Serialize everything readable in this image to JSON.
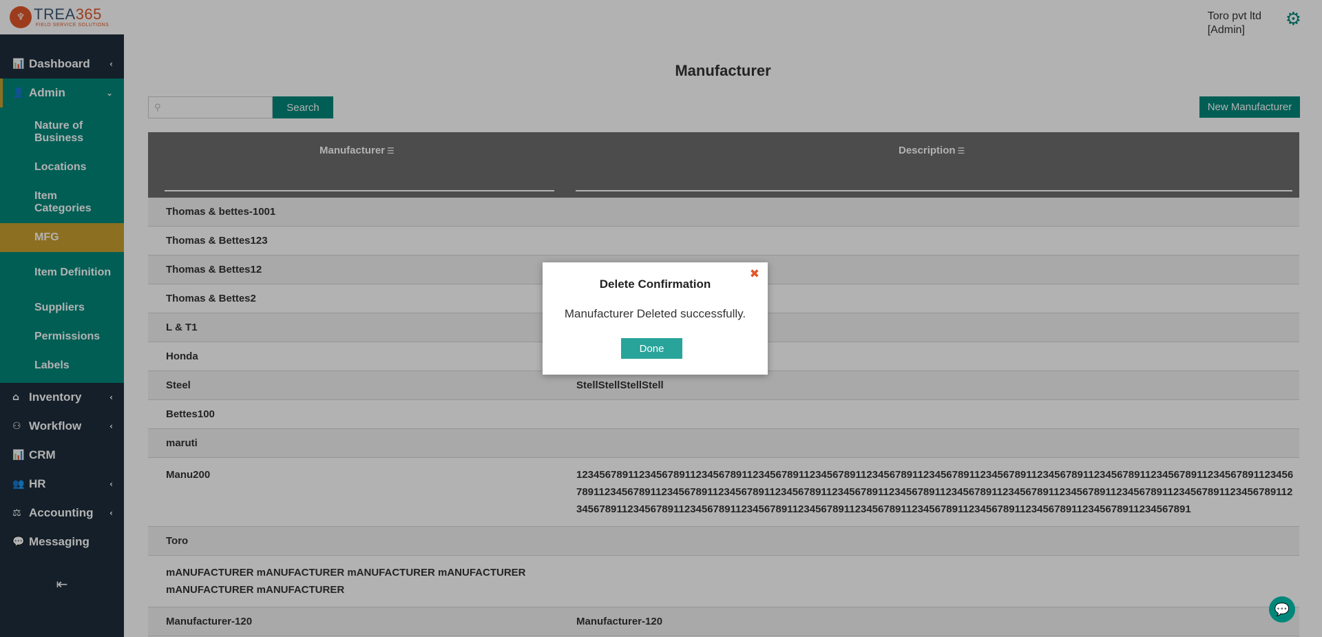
{
  "app": {
    "logo_mark": "♆",
    "logo_name_prefix": "TREA",
    "logo_name_accent": "365",
    "logo_subtitle": "FIELD SERVICE SOLUTIONS"
  },
  "header": {
    "user_name": "Toro pvt ltd",
    "user_role": "[Admin]",
    "settings_icon": "gear-icon"
  },
  "sidebar": {
    "items": [
      {
        "label": "Dashboard",
        "icon": "bar-chart-icon"
      },
      {
        "label": "Admin",
        "icon": "user-icon"
      },
      {
        "label": "Inventory",
        "icon": "home-icon"
      },
      {
        "label": "Workflow",
        "icon": "workflow-icon"
      },
      {
        "label": "CRM",
        "icon": "bar-chart-icon"
      },
      {
        "label": "HR",
        "icon": "users-icon"
      },
      {
        "label": "Accounting",
        "icon": "scale-icon"
      },
      {
        "label": "Messaging",
        "icon": "chat-icon"
      }
    ],
    "admin_sub": [
      {
        "label": "Nature of Business"
      },
      {
        "label": "Locations"
      },
      {
        "label": "Item Categories"
      },
      {
        "label": "MFG"
      },
      {
        "label": "Item Definition"
      },
      {
        "label": "Suppliers"
      },
      {
        "label": "Permissions"
      },
      {
        "label": "Labels"
      }
    ]
  },
  "page": {
    "title": "Manufacturer",
    "search_value": "",
    "search_button": "Search",
    "new_button": "New Manufacturer"
  },
  "table": {
    "columns": [
      "Manufacturer",
      "Description"
    ],
    "rows": [
      [
        "Thomas & bettes-1001",
        ""
      ],
      [
        "Thomas & Bettes123",
        ""
      ],
      [
        "Thomas & Bettes12",
        ""
      ],
      [
        "Thomas & Bettes2",
        ""
      ],
      [
        "L & T1",
        ""
      ],
      [
        "Honda",
        ""
      ],
      [
        "Steel",
        "StellStellStellStell"
      ],
      [
        "Bettes100",
        ""
      ],
      [
        "maruti",
        ""
      ],
      [
        "Manu200",
        "123456789112345678911234567891123456789112345678911234567891123456789112345678911234567891123456789112345678911234567891123456789112345678911234567891123456789112345678911234567891123456789112345678911234567891123456789112345678911234567891123456789112345678911234567891123456789112345678911234567891123456789112345678911234567891123456789112345678911234567891"
      ],
      [
        "Toro",
        ""
      ],
      [
        "mANUFACTURER mANUFACTURER mANUFACTURER mANUFACTURER mANUFACTURER mANUFACTURER",
        ""
      ],
      [
        "Manufacturer-120",
        "Manufacturer-120"
      ]
    ]
  },
  "modal": {
    "title": "Delete Confirmation",
    "message": "Manufacturer Deleted successfully.",
    "done_button": "Done",
    "close_symbol": "✖"
  }
}
